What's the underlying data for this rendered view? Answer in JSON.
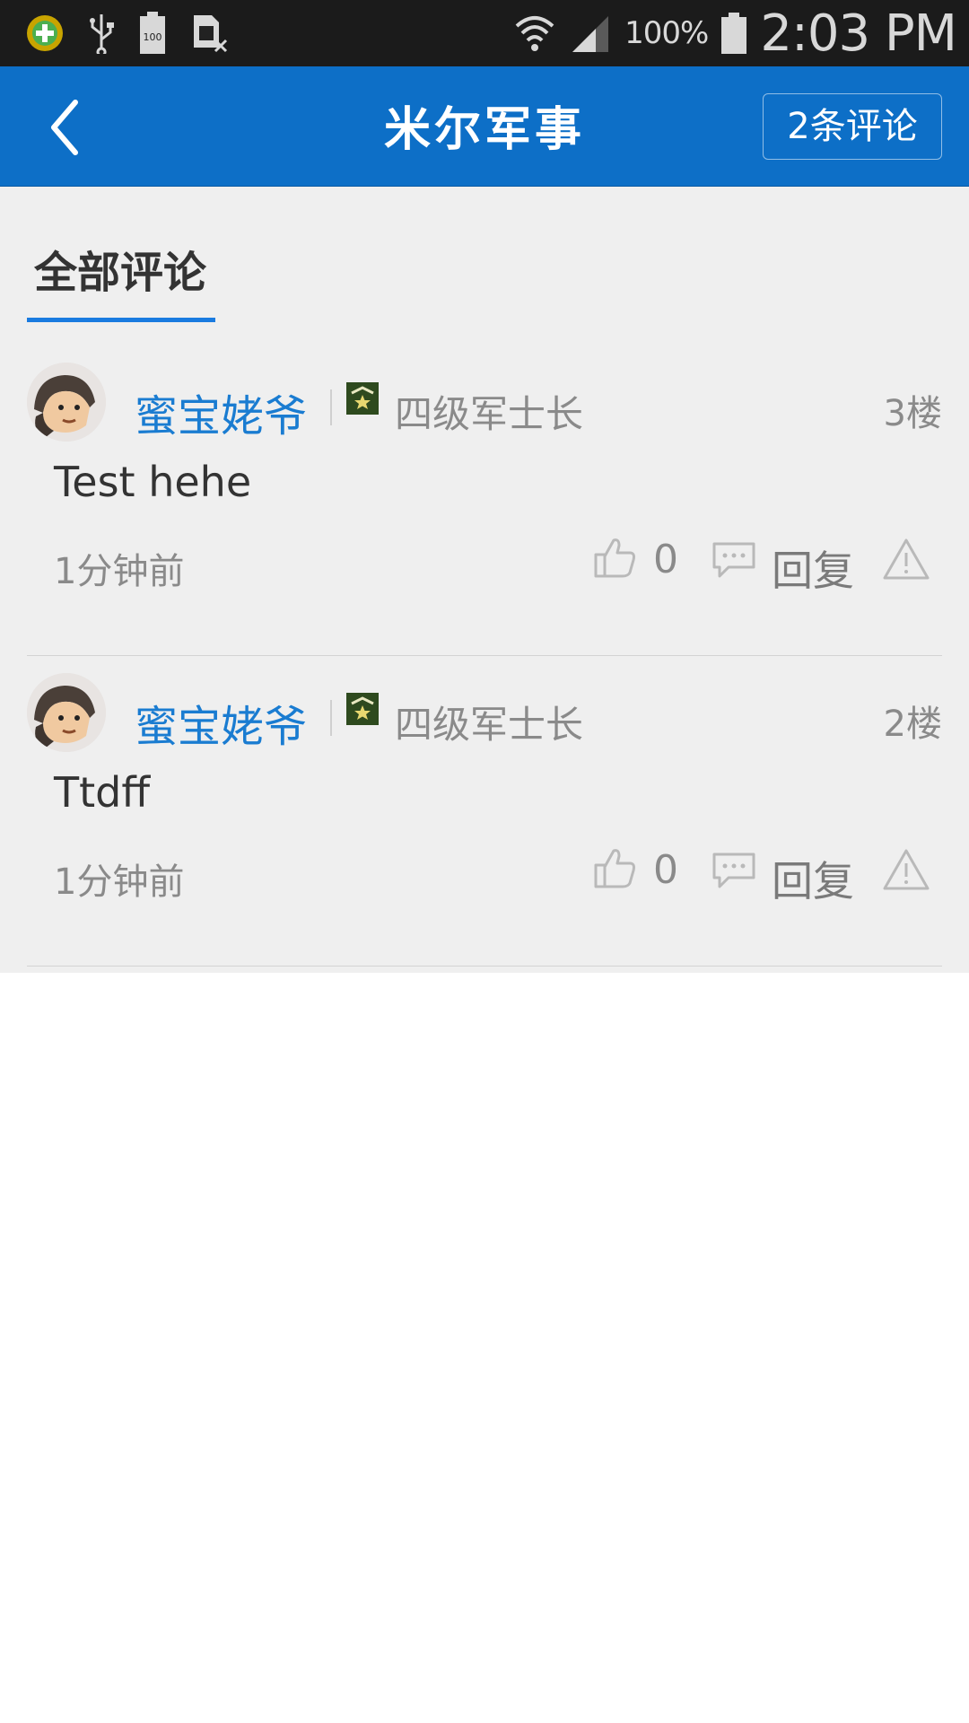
{
  "status_bar": {
    "battery_percent": "100%",
    "time": "2:03 PM",
    "icons": [
      "app-notification-icon",
      "usb-icon",
      "battery-100-icon",
      "sim-missing-icon",
      "wifi-icon",
      "cell-signal-icon",
      "battery-icon"
    ]
  },
  "header": {
    "title": "米尔军事",
    "comment_count_button": "2条评论",
    "back_icon": "chevron-left-icon"
  },
  "section": {
    "tab_label": "全部评论"
  },
  "comments": [
    {
      "username": "蜜宝姥爷",
      "rank": "四级军士长",
      "floor": "3楼",
      "text": "Test hehe",
      "time": "1分钟前",
      "likes": "0",
      "reply_label": "回复"
    },
    {
      "username": "蜜宝姥爷",
      "rank": "四级军士长",
      "floor": "2楼",
      "text": "Ttdff",
      "time": "1分钟前",
      "likes": "0",
      "reply_label": "回复"
    }
  ],
  "colors": {
    "header_bg": "#0d6fc7",
    "accent": "#1a7be0",
    "username": "#1a7cd1",
    "content_bg": "#efefef"
  }
}
